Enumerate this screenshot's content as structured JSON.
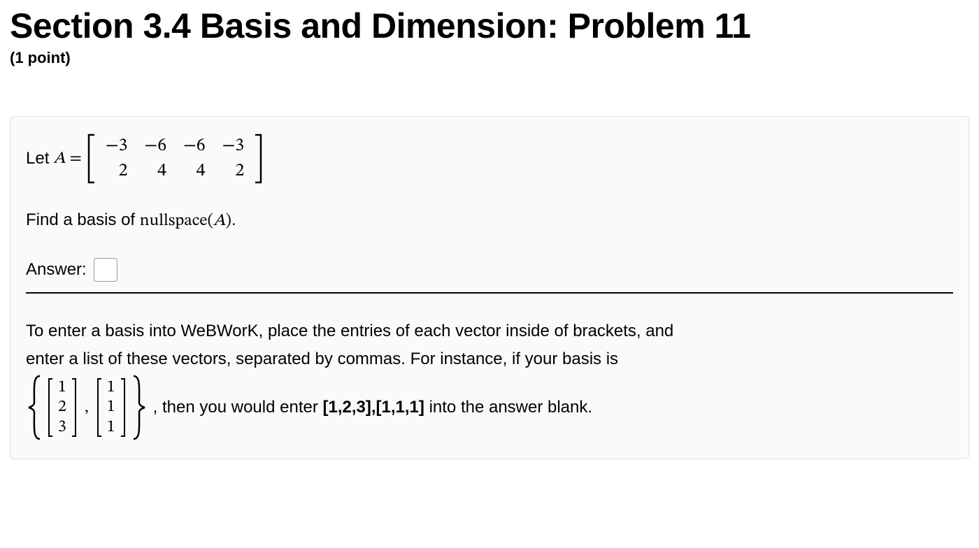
{
  "header": {
    "title": "Section 3.4 Basis and Dimension: Problem 11",
    "points": "(1 point)"
  },
  "problem": {
    "let_prefix": "Let ",
    "var_A": "A",
    "equals": " = ",
    "matrix_A": {
      "rows": [
        [
          "−3",
          "−6",
          "−6",
          "−3"
        ],
        [
          "2",
          "4",
          "4",
          "2"
        ]
      ]
    },
    "find_text_pre": "Find a basis of ",
    "nullspace_label": "nullspace",
    "find_arg": "A",
    "period": ".",
    "answer_label": "Answer:",
    "answer_value": "",
    "hint_line1": "To enter a basis into WeBWorK, place the entries of each vector inside of brackets, and",
    "hint_line2": "enter a list of these vectors, separated by commas. For instance, if your basis is",
    "example_basis": {
      "v1": [
        "1",
        "2",
        "3"
      ],
      "v2": [
        "1",
        "1",
        "1"
      ]
    },
    "hint_post_pre": ", then you would enter ",
    "hint_example_entry": "[1,2,3],[1,1,1]",
    "hint_post_suf": " into the answer blank."
  }
}
